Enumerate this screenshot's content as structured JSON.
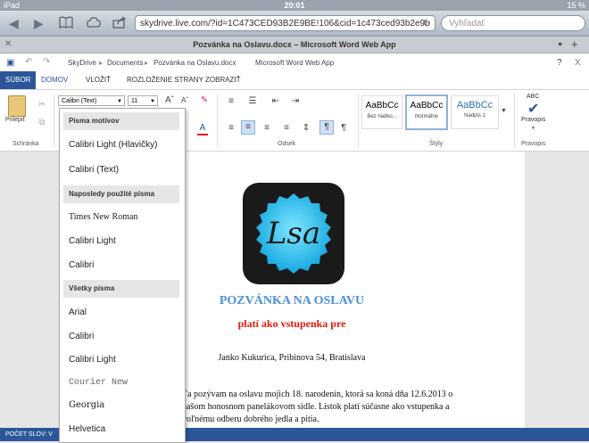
{
  "status_bar": {
    "device": "iPad",
    "time": "20:01",
    "battery": "15 %"
  },
  "safari": {
    "url": "skydrive.live.com/?id=1C473CED93B2E9BE!106&cid=1c473ced93b2e9b",
    "search_placeholder": "Vyhľadať"
  },
  "tab": {
    "title": "Pozvánka na Oslavu.docx – Microsoft Word Web App"
  },
  "word_header": {
    "breadcrumb": [
      "SkyDrive",
      "Documents",
      "Pozvánka na Oslavu.docx"
    ],
    "app_name": "Microsoft Word Web App",
    "help": "?",
    "close": "X"
  },
  "ribbon_tabs": [
    "SÚBOR",
    "DOMOV",
    "VLOŽIŤ",
    "ROZLOŽENIE STRANY",
    "ZOBRAZIŤ"
  ],
  "ribbon": {
    "font_name": "Calibri (Text)",
    "font_size": "11",
    "paste_label": "Prilepiť",
    "clipboard_group": "Schránka",
    "paragraph_group": "Odsek",
    "styles_group": "Štýly",
    "spelling_group": "Pravopis",
    "spelling_label": "Pravopis",
    "spelling_abc": "ABC",
    "styles": [
      {
        "sample": "AaBbCc",
        "name": "Bez riadko..."
      },
      {
        "sample": "AaBbCc",
        "name": "Normálne"
      },
      {
        "sample": "AaBbCc",
        "name": "Nadpis 1"
      }
    ]
  },
  "font_dropdown": {
    "sections": [
      {
        "header": "Písma motívov",
        "items": [
          "Calibri Light (Hlavičky)",
          "Calibri (Text)"
        ]
      },
      {
        "header": "Naposledy použité písma",
        "items": [
          "Times New Roman",
          "Calibri Light",
          "Calibri"
        ]
      },
      {
        "header": "Všetky písma",
        "items": [
          "Arial",
          "Calibri",
          "Calibri Light",
          "Courier New",
          "Georgia",
          "Helvetica"
        ]
      }
    ]
  },
  "document": {
    "logo_text": "Lsa",
    "title": "POZVÁNKA NA OSLAVU",
    "subtitle": "platí ako vstupenka pre",
    "address": "Janko Kukurica, Pribinova 54, Bratislava",
    "body_lines": [
      "Ťa pozývam na oslavu mojich 18. narodenín, ktorá sa koná dňa 12.6.2013 o",
      "našom honosnom panelákovom sídle. Listok platí súčasne ako vstupenka a",
      "voľnému odberu dobrého jedla a pitia."
    ]
  },
  "bottom_bar": {
    "word_count": "POČET SLOV: V"
  },
  "colors": {
    "word_blue": "#2b579a",
    "title_blue": "#4a90d9",
    "subtitle_red": "#e8160c"
  }
}
